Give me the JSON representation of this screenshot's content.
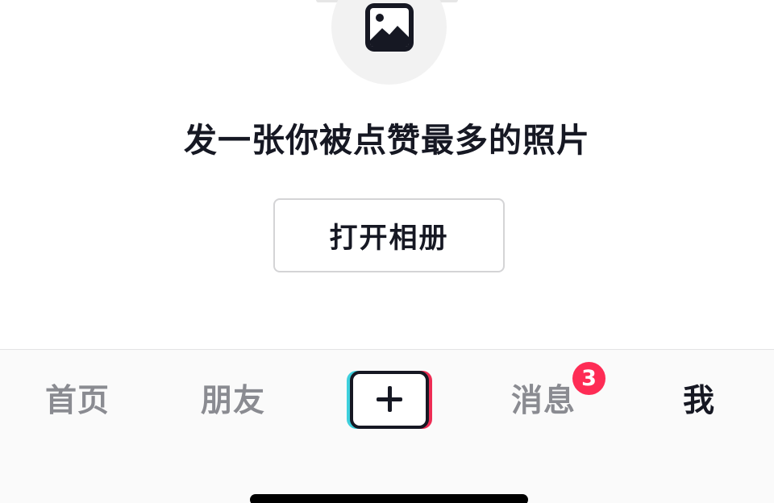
{
  "prompt": {
    "icon": "photo-icon",
    "title": "发一张你被点赞最多的照片",
    "open_album_label": "打开相册"
  },
  "tab_bar": {
    "tabs": [
      {
        "id": "home",
        "label": "首页",
        "active": false
      },
      {
        "id": "friends",
        "label": "朋友",
        "active": false
      },
      {
        "id": "create",
        "label": "",
        "icon": "plus-icon",
        "active": false
      },
      {
        "id": "messages",
        "label": "消息",
        "badge": "3",
        "active": false
      },
      {
        "id": "me",
        "label": "我",
        "active": true
      }
    ]
  },
  "colors": {
    "text_primary": "#161823",
    "text_inactive": "#8a8b91",
    "badge": "#fe2c55",
    "create_cyan": "#3ed0dd",
    "create_red": "#ee2c54"
  }
}
